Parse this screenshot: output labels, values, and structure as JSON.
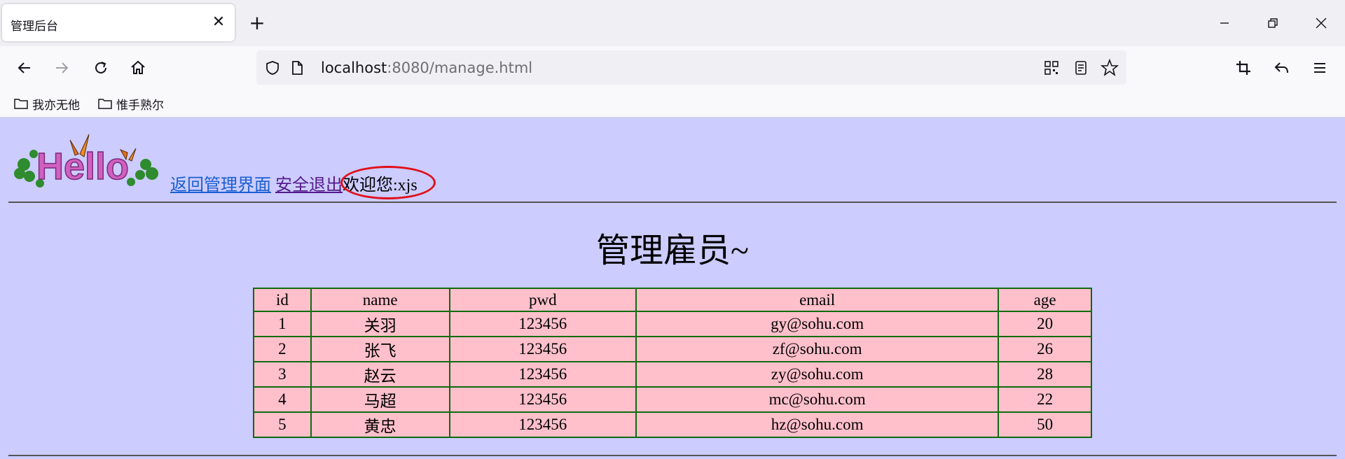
{
  "browser": {
    "tab_title": "管理后台",
    "url_host": "localhost",
    "url_rest": ":8080/manage.html",
    "bookmarks": [
      "我亦无他",
      "惟手熟尔"
    ]
  },
  "page": {
    "logo_text": "Hello",
    "links": {
      "back": "返回管理界面",
      "logout": "安全退出"
    },
    "welcome": "欢迎您:xjs",
    "title": "管理雇员~",
    "table": {
      "headers": [
        "id",
        "name",
        "pwd",
        "email",
        "age"
      ],
      "rows": [
        [
          "1",
          "关羽",
          "123456",
          "gy@sohu.com",
          "20"
        ],
        [
          "2",
          "张飞",
          "123456",
          "zf@sohu.com",
          "26"
        ],
        [
          "3",
          "赵云",
          "123456",
          "zy@sohu.com",
          "28"
        ],
        [
          "4",
          "马超",
          "123456",
          "mc@sohu.com",
          "22"
        ],
        [
          "5",
          "黄忠",
          "123456",
          "hz@sohu.com",
          "50"
        ]
      ]
    }
  },
  "colors": {
    "page_bg": "#ccccff",
    "table_bg": "#ffc0cb",
    "table_border": "#0e6b0e",
    "highlight_ellipse": "#e0101a"
  }
}
